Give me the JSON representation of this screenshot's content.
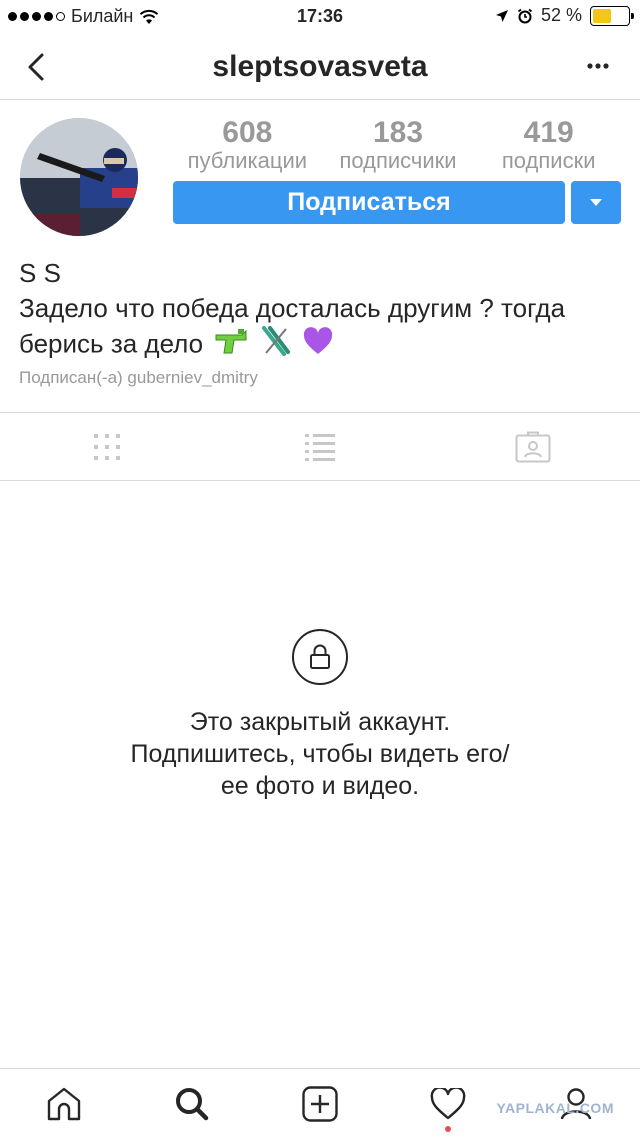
{
  "status_bar": {
    "carrier": "Билайн",
    "time": "17:36",
    "battery_percent": "52 %",
    "battery_level": 0.52,
    "signal_bars": 4
  },
  "header": {
    "username": "sleptsovasveta",
    "back_icon": "chevron-left-icon",
    "more_icon": "ellipsis-icon"
  },
  "profile": {
    "stats": [
      {
        "value": "608",
        "label": "публикации"
      },
      {
        "value": "183",
        "label": "подписчики"
      },
      {
        "value": "419",
        "label": "подписки"
      }
    ],
    "follow_label": "Подписаться",
    "name": "S S",
    "bio_text": "Задело что победа досталась другим ? тогда берись за дело",
    "bio_emoji": [
      "water-pistol",
      "skis",
      "purple-heart"
    ],
    "followed_by": "Подписан(-а) guberniev_dmitry"
  },
  "tabs": [
    {
      "icon": "grid-icon",
      "active": false
    },
    {
      "icon": "list-icon",
      "active": false
    },
    {
      "icon": "tagged-icon",
      "active": false
    }
  ],
  "private": {
    "icon": "lock-icon",
    "line1": "Это закрытый аккаунт.",
    "line2": "Подпишитесь, чтобы видеть его/",
    "line3": "ее фото и видео."
  },
  "tabbar": [
    {
      "icon": "home-icon"
    },
    {
      "icon": "search-icon",
      "active": true
    },
    {
      "icon": "add-post-icon"
    },
    {
      "icon": "heart-icon",
      "has_notification": true
    },
    {
      "icon": "profile-icon"
    }
  ],
  "watermark": "YAPLAKAL.COM",
  "colors": {
    "accent": "#3897f0",
    "muted": "#999999",
    "border": "#dbdbdb",
    "notification": "#ed4956"
  }
}
